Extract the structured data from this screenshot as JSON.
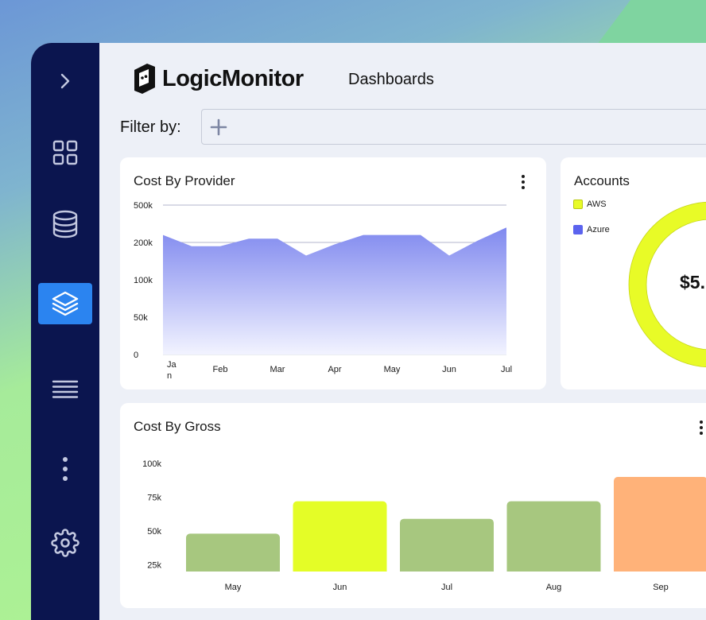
{
  "app": {
    "brand": "LogicMonitor",
    "page_title": "Dashboards",
    "filter_label": "Filter by:"
  },
  "sidebar": {
    "items": [
      {
        "icon": "chevron-right-icon",
        "active": false
      },
      {
        "icon": "grid-icon",
        "active": false
      },
      {
        "icon": "database-icon",
        "active": false
      },
      {
        "icon": "layers-icon",
        "active": true
      },
      {
        "icon": "list-icon",
        "active": false
      },
      {
        "icon": "more-vertical-icon",
        "active": false
      },
      {
        "icon": "gear-icon",
        "active": false
      }
    ]
  },
  "colors": {
    "sidebar_bg": "#0b154f",
    "sidebar_active": "#2b84f0",
    "area_top": "#8089ef",
    "aws": "#e8fb27",
    "azure": "#5b63ee",
    "bar_green": "#a7c77f",
    "bar_yellow": "#e4fd27",
    "bar_orange": "#ffb279"
  },
  "cost_by_provider": {
    "title": "Cost By Provider",
    "chart_data": {
      "type": "area",
      "categories": [
        "Jan",
        "Feb",
        "Mar",
        "Apr",
        "May",
        "Jun",
        "Jul"
      ],
      "y_tick_labels": [
        "500k",
        "200k",
        "100k",
        "50k",
        "0"
      ],
      "values": [
        3.2,
        2.9,
        2.9,
        3.1,
        3.1,
        2.65,
        2.95,
        3.2,
        3.2,
        3.2,
        2.65,
        3.05,
        3.4
      ],
      "point_x": [
        0,
        0.5,
        1,
        1.5,
        2,
        2.5,
        3,
        3.5,
        4,
        4.5,
        5,
        5.5,
        6
      ],
      "note": "y positions on category axis scale: 0=0,1=50k,2=100k,3=200k,4=500k",
      "ylim": [
        0,
        4
      ],
      "grid": true
    }
  },
  "accounts": {
    "title": "Accounts",
    "legend": [
      {
        "label": "AWS",
        "color": "#e8fb27"
      },
      {
        "label": "Azure",
        "color": "#5b63ee"
      }
    ],
    "total": "$5."
  },
  "cost_by_gross": {
    "title": "Cost By Gross",
    "chart_data": {
      "type": "bar",
      "categories": [
        "May",
        "Jun",
        "Jul",
        "Aug",
        "Sep"
      ],
      "values": [
        48,
        72,
        59,
        72,
        90
      ],
      "colors": [
        "#a7c77f",
        "#e4fd27",
        "#a7c77f",
        "#a7c77f",
        "#ffb279"
      ],
      "y_tick_labels": [
        "100k",
        "75k",
        "50k",
        "25k"
      ],
      "y_ticks": [
        100,
        75,
        50,
        25
      ],
      "ylim": [
        20,
        100
      ],
      "unit": "k"
    }
  }
}
